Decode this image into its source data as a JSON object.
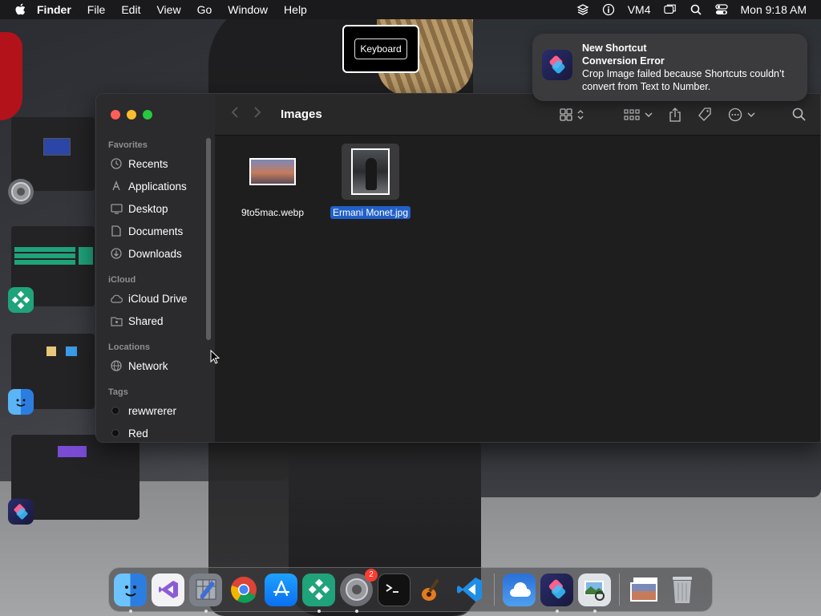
{
  "menubar": {
    "app_name": "Finder",
    "menus": [
      "File",
      "Edit",
      "View",
      "Go",
      "Window",
      "Help"
    ],
    "status_items": [
      "layers-icon",
      "accessibility-icon",
      "VM4",
      "window-icon",
      "spotlight-icon",
      "control-center-icon"
    ],
    "vm_label": "VM4",
    "clock": "Mon 9:18 AM"
  },
  "keyboard_overlay": {
    "label": "Keyboard"
  },
  "notification": {
    "title_line1": "New Shortcut",
    "title_line2": "Conversion Error",
    "body": "Crop Image failed because Shortcuts couldn’t convert from Text to Number."
  },
  "finder": {
    "title": "Images",
    "sidebar": {
      "favorites_header": "Favorites",
      "favorites": [
        {
          "label": "Recents",
          "icon": "clock-icon"
        },
        {
          "label": "Applications",
          "icon": "applications-icon"
        },
        {
          "label": "Desktop",
          "icon": "desktop-icon"
        },
        {
          "label": "Documents",
          "icon": "document-icon"
        },
        {
          "label": "Downloads",
          "icon": "download-icon"
        }
      ],
      "icloud_header": "iCloud",
      "icloud": [
        {
          "label": "iCloud Drive",
          "icon": "cloud-icon"
        },
        {
          "label": "Shared",
          "icon": "shared-folder-icon"
        }
      ],
      "locations_header": "Locations",
      "locations": [
        {
          "label": "Network",
          "icon": "network-icon"
        }
      ],
      "tags_header": "Tags",
      "tags": [
        {
          "label": "rewwrerer",
          "color": "#101010"
        },
        {
          "label": "Red",
          "color": "#101010"
        }
      ]
    },
    "files": [
      {
        "name": "9to5mac.webp",
        "selected": false
      },
      {
        "name": "Ermani Monet.jpg",
        "selected": true
      }
    ]
  },
  "dock": {
    "apps": [
      "Finder",
      "Visual Studio",
      "Script Editor",
      "Chrome",
      "App Store",
      "Network Radar",
      "System Settings",
      "Terminal",
      "GarageBand",
      "VS Code",
      "iCloud Weather",
      "Shortcuts",
      "Preview"
    ],
    "settings_badge": "2"
  },
  "colors": {
    "accent": "#2160c8",
    "traffic_red": "#fe5f57",
    "traffic_yellow": "#febc2e",
    "traffic_green": "#28c840"
  }
}
